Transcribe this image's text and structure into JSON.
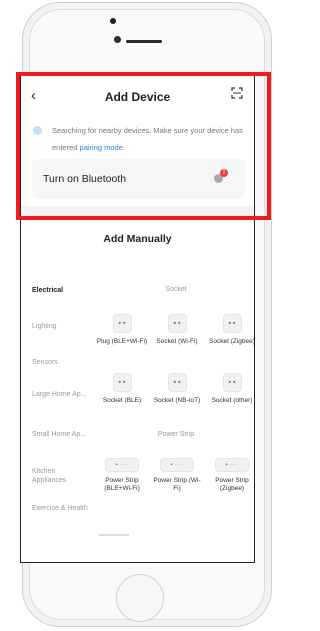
{
  "header": {
    "back_icon": "chevron-left-icon",
    "back_glyph": "‹",
    "title": "Add Device",
    "scan_icon": "scan-icon"
  },
  "search": {
    "text": "Searching for nearby devices. Make sure your device has entered ",
    "link": "pairing mode",
    "end": "."
  },
  "bluetooth": {
    "label": "Turn on Bluetooth",
    "icon": "bluetooth-icon",
    "badge": "!"
  },
  "manual": {
    "title": "Add Manually"
  },
  "categories": [
    {
      "label": "Electrical",
      "active": true
    },
    {
      "label": "Lighting",
      "active": false
    },
    {
      "label": "Sensors",
      "active": false
    },
    {
      "label": "Large Home Ap...",
      "active": false
    },
    {
      "label": "Small Home Ap...",
      "active": false
    },
    {
      "label": "Kitchen Appliances",
      "active": false
    },
    {
      "label": "Exercise & Health",
      "active": false
    }
  ],
  "sections": [
    {
      "title": "Socket",
      "devices": [
        {
          "label": "Plug (BLE+Wi-Fi)",
          "glyph": "▪ ▪"
        },
        {
          "label": "Socket (Wi-Fi)",
          "glyph": "▪ ▪"
        },
        {
          "label": "Socket (Zigbee)",
          "glyph": "▪ ▪"
        },
        {
          "label": "Socket (BLE)",
          "glyph": "▪ ▪"
        },
        {
          "label": "Socket (NB-IoT)",
          "glyph": "▪ ▪"
        },
        {
          "label": "Socket (other)",
          "glyph": "▪ ▪"
        }
      ]
    },
    {
      "title": "Power Strip",
      "devices": [
        {
          "label": "Power Strip (BLE+Wi-Fi)",
          "glyph": "▪ ∙∙∙∙"
        },
        {
          "label": "Power Strip (Wi-Fi)",
          "glyph": "▪ ∙∙∙∙"
        },
        {
          "label": "Power Strip (Zigbee)",
          "glyph": "▪ ∙∙∙∙"
        }
      ]
    }
  ],
  "colors": {
    "accent": "#2d7de0",
    "highlight": "#ee1c1c",
    "badge": "#e53b3b"
  }
}
